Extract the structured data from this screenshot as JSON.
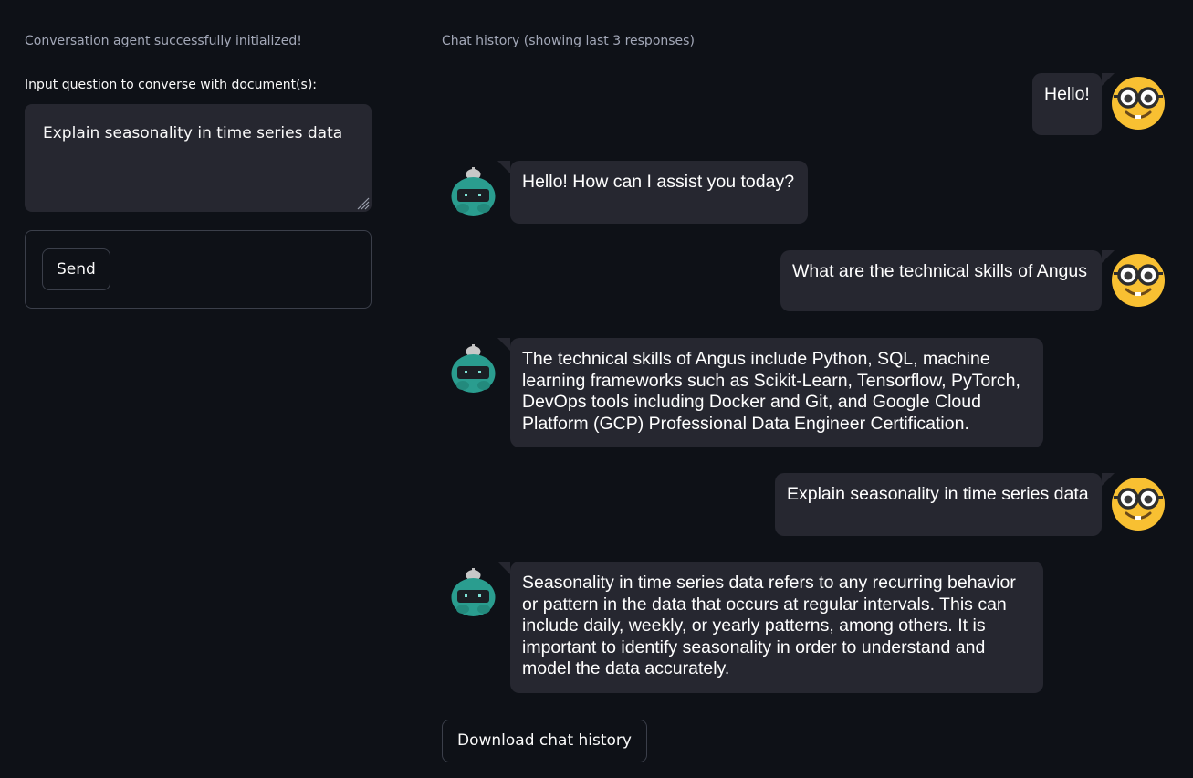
{
  "sidebar": {
    "status_message": "Conversation agent successfully initialized!",
    "input_label": "Input question to converse with document(s):",
    "input_value": "Explain seasonality in time series data",
    "send_label": "Send"
  },
  "chat": {
    "title": "Chat history (showing last 3 responses)",
    "messages": [
      {
        "role": "user",
        "text": "Hello!",
        "avatar": "nerd-face-icon"
      },
      {
        "role": "assistant",
        "text": "Hello! How can I assist you today?",
        "avatar": "robot-icon"
      },
      {
        "role": "user",
        "text": "What are the technical skills of Angus",
        "avatar": "nerd-face-icon"
      },
      {
        "role": "assistant",
        "text": "The technical skills of Angus include Python, SQL, machine learning frameworks such as Scikit-Learn, Tensorflow, PyTorch, DevOps tools including Docker and Git, and Google Cloud Platform (GCP) Professional Data Engineer Certification.",
        "avatar": "robot-icon"
      },
      {
        "role": "user",
        "text": "Explain seasonality in time series data",
        "avatar": "nerd-face-icon"
      },
      {
        "role": "assistant",
        "text": "Seasonality in time series data refers to any recurring behavior or pattern in the data that occurs at regular intervals. This can include daily, weekly, or yearly patterns, among others. It is important to identify seasonality in order to understand and model the data accurately.",
        "avatar": "robot-icon"
      }
    ],
    "download_label": "Download chat history"
  },
  "colors": {
    "background": "#0e1117",
    "bubble": "#262730",
    "border": "#3b3f4a",
    "muted_text": "#a3a8b8",
    "user_avatar": "#f8c032",
    "bot_avatar": "#2a9d8f"
  }
}
